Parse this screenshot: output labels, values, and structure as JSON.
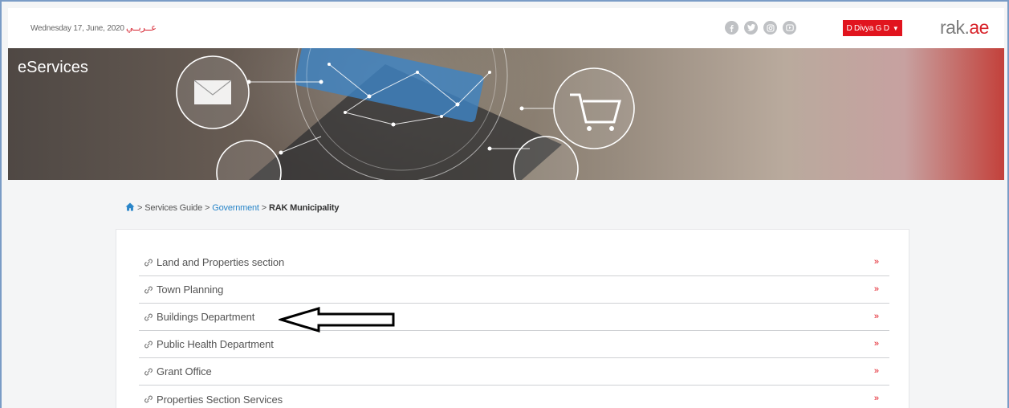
{
  "header": {
    "date": "Wednesday 17, June, 2020",
    "arabic_link": "عــربــي",
    "user_label": "D Divya G D",
    "logo_main": "rak.",
    "logo_accent": "ae"
  },
  "socials": [
    {
      "icon": "facebook-icon"
    },
    {
      "icon": "twitter-icon"
    },
    {
      "icon": "instagram-icon"
    },
    {
      "icon": "youtube-icon"
    }
  ],
  "banner": {
    "title": "eServices"
  },
  "breadcrumb": {
    "services_guide": "Services Guide",
    "government": "Government",
    "current": "RAK Municipality"
  },
  "sections": [
    {
      "label": "Land and Properties section"
    },
    {
      "label": "Town Planning"
    },
    {
      "label": "Buildings Department"
    },
    {
      "label": "Public Health Department"
    },
    {
      "label": "Grant Office"
    },
    {
      "label": "Properties Section Services"
    }
  ],
  "colors": {
    "accent": "#e1141e",
    "link": "#2a86c9"
  }
}
